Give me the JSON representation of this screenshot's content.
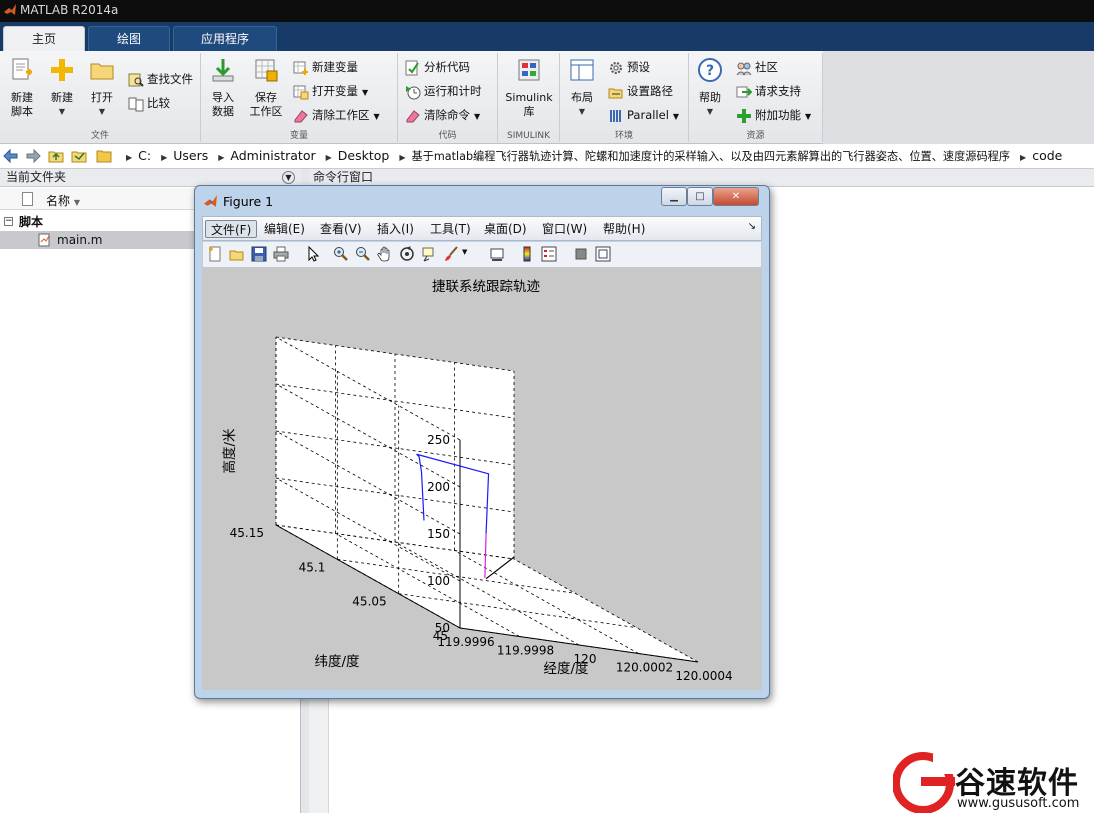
{
  "app": {
    "title": "MATLAB R2014a"
  },
  "ribbon": {
    "tabs": [
      {
        "label": "主页"
      },
      {
        "label": "绘图"
      },
      {
        "label": "应用程序"
      }
    ],
    "groups": {
      "file": {
        "name": "文件",
        "new_script": "新建\n脚本",
        "new": "新建",
        "open": "打开",
        "find_files": "查找文件",
        "compare": "比较"
      },
      "variable": {
        "name": "变量",
        "import_data": "导入\n数据",
        "save_workspace": "保存\n工作区",
        "new_variable": "新建变量",
        "open_variable": "打开变量",
        "clear_workspace": "清除工作区"
      },
      "code": {
        "name": "代码",
        "analyze_code": "分析代码",
        "run_and_time": "运行和计时",
        "clear_commands": "清除命令"
      },
      "simulink": {
        "name": "SIMULINK",
        "library": "Simulink\n库"
      },
      "environment": {
        "name": "环境",
        "layout": "布局",
        "preferences": "预设",
        "set_path": "设置路径",
        "parallel": "Parallel"
      },
      "resources": {
        "name": "资源",
        "help": "帮助",
        "community": "社区",
        "request_support": "请求支持",
        "add_ons": "附加功能"
      }
    }
  },
  "address_bar": {
    "crumbs": [
      "C:",
      "Users",
      "Administrator",
      "Desktop",
      "基于matlab编程飞行器轨迹计算、陀螺和加速度计的采样输入、以及由四元素解算出的飞行器姿态、位置、速度源码程序",
      "code"
    ]
  },
  "current_folder": {
    "title": "当前文件夹",
    "column_name": "名称",
    "group": "脚本",
    "files": [
      {
        "name": "main.m"
      }
    ]
  },
  "command_window": {
    "title": "命令行窗口"
  },
  "figure": {
    "title": "Figure 1",
    "menus": [
      "文件(F)",
      "编辑(E)",
      "查看(V)",
      "插入(I)",
      "工具(T)",
      "桌面(D)",
      "窗口(W)",
      "帮助(H)"
    ]
  },
  "chart_data": {
    "type": "line",
    "projection": "3d",
    "title": "捷联系统跟踪轨迹",
    "xlabel": "经度/度",
    "ylabel": "纬度/度",
    "zlabel": "高度/米",
    "x_ticks": [
      "119.9996",
      "119.9998",
      "120",
      "120.0002",
      "120.0004"
    ],
    "y_ticks": [
      "45",
      "45.05",
      "45.1",
      "45.15"
    ],
    "z_ticks": [
      "50",
      "100",
      "150",
      "200",
      "250"
    ],
    "xlim": [
      119.9996,
      120.0004
    ],
    "ylim": [
      45,
      45.15
    ],
    "zlim": [
      50,
      250
    ],
    "grid": "dashed",
    "series": [
      {
        "color": "#1a1aff",
        "x": [
          119.99985,
          119.99985,
          119.99985,
          119.99985,
          120.0001,
          120.0001
        ],
        "y": [
          45.09,
          45.092,
          45.094,
          45.096,
          45.098,
          45.1
        ],
        "z": [
          110,
          160,
          175,
          176,
          165,
          100
        ]
      },
      {
        "color": "#e020e0",
        "x": [
          120.0001,
          120.0001
        ],
        "y": [
          45.1,
          45.101
        ],
        "z": [
          100,
          52
        ]
      },
      {
        "color": "#000000",
        "x": [
          120.0001,
          120.0004
        ],
        "y": [
          45.1,
          45.15
        ],
        "z": [
          52,
          52
        ]
      }
    ]
  },
  "watermark": {
    "brand": "谷速软件",
    "url": "www.gususoft.com"
  }
}
